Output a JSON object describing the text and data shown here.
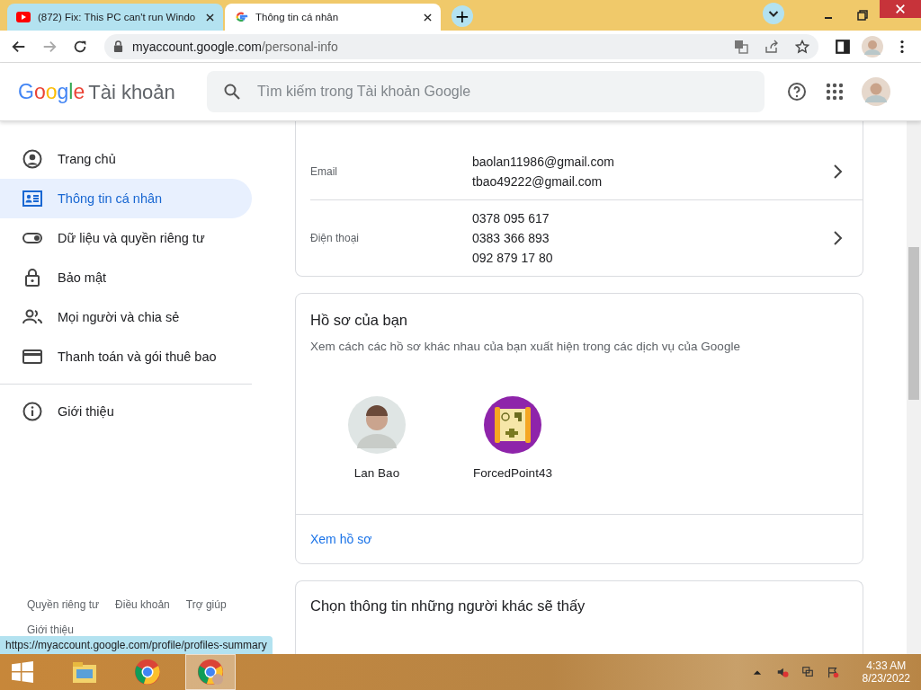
{
  "browser": {
    "tabs": [
      {
        "title": "(872) Fix: This PC can't run Windo",
        "selected": false
      },
      {
        "title": "Thông tin cá nhân",
        "selected": true
      }
    ],
    "new_tab": "+",
    "address_host": "myaccount.google.com",
    "address_path": "/personal-info"
  },
  "header": {
    "logo": "Google",
    "product": "Tài khoản",
    "search_placeholder": "Tìm kiếm trong Tài khoản Google"
  },
  "sidebar": {
    "items": [
      {
        "label": "Trang chủ",
        "selected": false
      },
      {
        "label": "Thông tin cá nhân",
        "selected": true
      },
      {
        "label": "Dữ liệu và quyền riêng tư",
        "selected": false
      },
      {
        "label": "Bảo mật",
        "selected": false
      },
      {
        "label": "Mọi người và chia sẻ",
        "selected": false
      },
      {
        "label": "Thanh toán và gói thuê bao",
        "selected": false
      }
    ],
    "extra_items": [
      {
        "label": "Giới thiệu",
        "selected": false
      }
    ],
    "footer_links": [
      "Quyền riêng tư",
      "Điều khoản",
      "Trợ giúp"
    ],
    "footer_about": "Giới thiệu"
  },
  "contact": {
    "rows": [
      {
        "label": "Email",
        "values": [
          "baolan11986@gmail.com",
          "tbao49222@gmail.com"
        ]
      },
      {
        "label": "Điện thoại",
        "values": [
          "0378 095 617",
          "0383 366 893",
          "092 879 17 80"
        ]
      }
    ]
  },
  "profiles_card": {
    "title": "Hồ sơ của bạn",
    "description": "Xem cách các hồ sơ khác nhau của bạn xuất hiện trong các dịch vụ của Google",
    "profiles": [
      {
        "name": "Lan Bao",
        "kind": "photo"
      },
      {
        "name": "ForcedPoint43",
        "kind": "game"
      }
    ],
    "link": "Xem hồ sơ"
  },
  "next_card": {
    "title": "Chọn thông tin những người khác sẽ thấy"
  },
  "status_url": "https://myaccount.google.com/profile/profiles-summary",
  "taskbar": {
    "apps": [
      {
        "kind": "explorer",
        "selected": false
      },
      {
        "kind": "chrome",
        "selected": false
      },
      {
        "kind": "chrome-profile",
        "selected": true
      }
    ],
    "time": "4:33 AM",
    "date": "8/23/2022"
  }
}
